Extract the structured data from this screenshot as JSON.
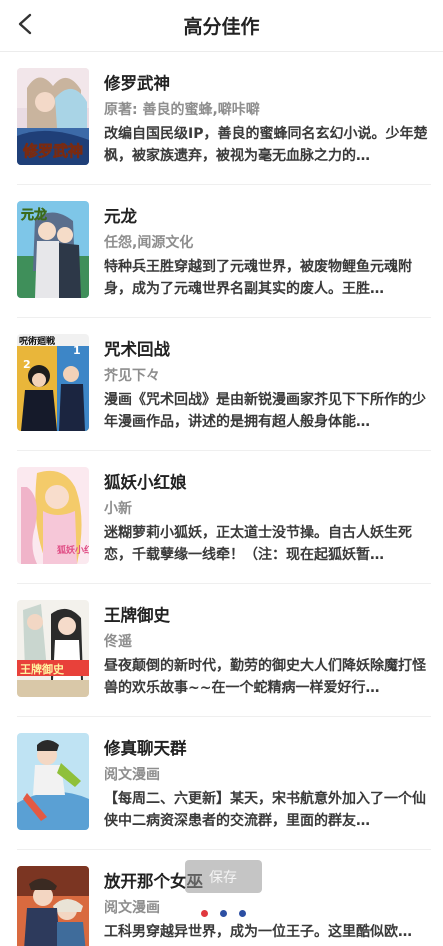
{
  "header": {
    "title": "高分佳作",
    "back_icon": "chevron-left-icon"
  },
  "items": [
    {
      "title": "修罗武神",
      "author": "原著: 善良的蜜蜂,噼咔噼",
      "desc": "改编自国民级IP，善良的蜜蜂同名玄幻小说。少年楚枫，被家族遗弃，被视为毫无血脉之力的…"
    },
    {
      "title": "元龙",
      "author": "任怨,闻源文化",
      "desc": "特种兵王胜穿越到了元魂世界，被废物鲤鱼元魂附身，成为了元魂世界名副其实的废人。王胜…"
    },
    {
      "title": "咒术回战",
      "author": "芥见下々",
      "desc": "漫画《咒术回战》是由新锐漫画家芥见下下所作的少年漫画作品，讲述的是拥有超人般身体能…"
    },
    {
      "title": "狐妖小红娘",
      "author": "小新",
      "desc": "迷糊萝莉小狐妖，正太道士没节操。自古人妖生死恋，千载孽缘一线牵！（注：现在起狐妖暂…"
    },
    {
      "title": "王牌御史",
      "author": "佟遥",
      "desc": "昼夜颠倒的新时代，勤劳的御史大人们降妖除魔打怪兽的欢乐故事~~在一个蛇精病一样爱好行…"
    },
    {
      "title": "修真聊天群",
      "author": "阅文漫画",
      "desc": "【每周二、六更新】某天，宋书航意外加入了一个仙侠中二病资深患者的交流群，里面的群友…"
    },
    {
      "title": "放开那个女巫",
      "author": "阅文漫画",
      "desc": "工科男穿越异世界，成为一位王子。这里酷似欧…"
    }
  ],
  "cover_text": {
    "cover1": "修罗武神",
    "cover2": "元龙",
    "cover3": "呪術廻戦",
    "cover4": "狐妖小红娘",
    "cover5": "王牌御史"
  },
  "toast": {
    "text": "保存"
  },
  "loader_colors": [
    "#e0383e",
    "#2c4fa3",
    "#2c4fa3"
  ]
}
